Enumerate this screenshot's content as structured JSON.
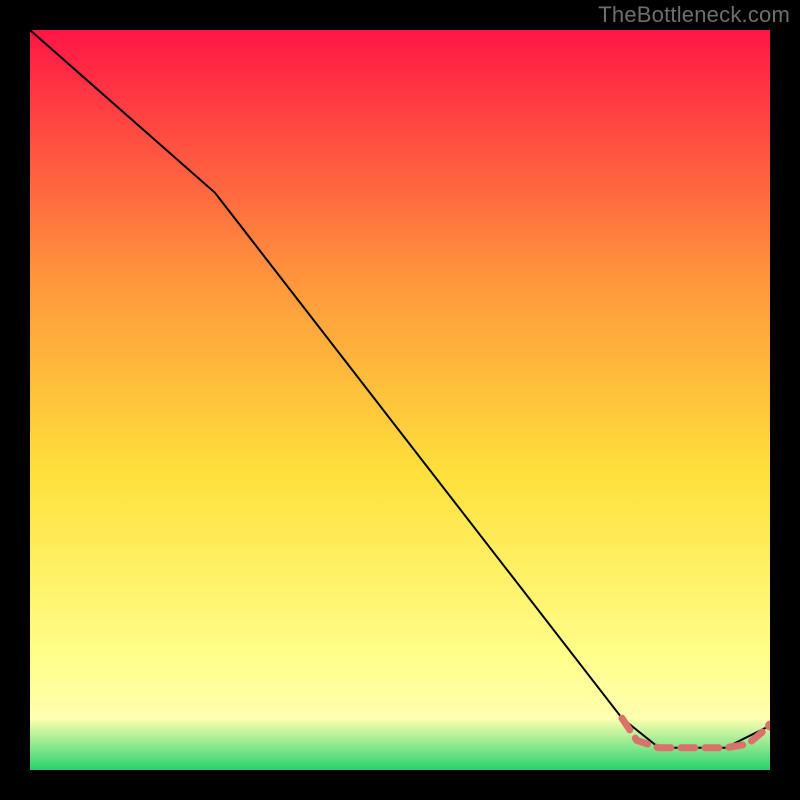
{
  "watermark": "TheBottleneck.com",
  "chart_data": {
    "type": "line",
    "title": "",
    "xlabel": "",
    "ylabel": "",
    "xlim": [
      0,
      100
    ],
    "ylim": [
      0,
      100
    ],
    "grid": false,
    "legend": false,
    "background_gradient": {
      "top": "#FF1646",
      "mid_upper": "#FF9A3C",
      "mid": "#FFE03C",
      "mid_lower": "#FFFF8C",
      "narrow_band": "#FFFFB0",
      "bottom": "#28D26E"
    },
    "series": [
      {
        "name": "main-curve",
        "style": "solid",
        "color": "#000000",
        "x": [
          0,
          25,
          80,
          85,
          94,
          100
        ],
        "y": [
          100,
          78,
          7,
          3,
          3,
          6
        ]
      },
      {
        "name": "highlight-segment",
        "style": "thick-dashed",
        "color": "#D9736A",
        "x": [
          80,
          82,
          85,
          88,
          91,
          94,
          97,
          100
        ],
        "y": [
          7,
          4,
          3,
          3,
          3,
          3,
          3.5,
          6
        ]
      }
    ],
    "markers": [
      {
        "x": 100,
        "y": 6,
        "color": "#D9736A",
        "r": 5
      }
    ]
  }
}
